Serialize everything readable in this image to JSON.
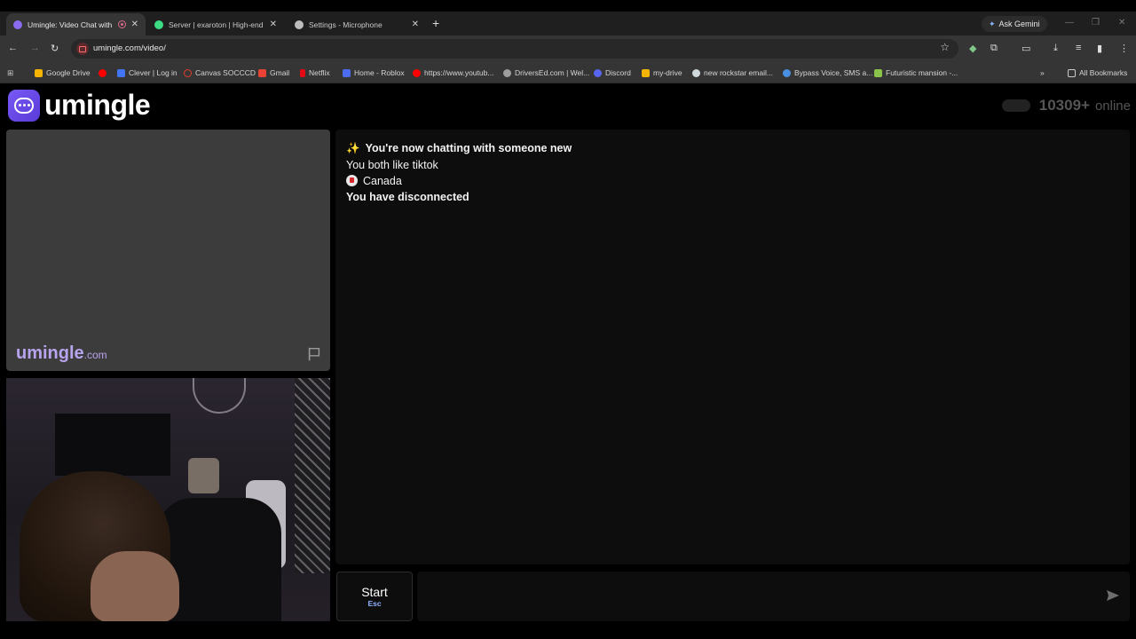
{
  "browser": {
    "tabs": [
      {
        "title": "Umingle: Video Chat with S",
        "active": true,
        "favicon_color": "#8b6cf0"
      },
      {
        "title": "Server | exaroton | High-end on",
        "active": false,
        "favicon_color": "#3ddc84"
      },
      {
        "title": "Settings - Microphone",
        "active": false,
        "favicon_color": "#bdbdbd"
      }
    ],
    "new_tab": "+",
    "ask_gemini": "Ask Gemini",
    "url": "umingle.com/video/",
    "bookmarks": [
      {
        "label": "Google Drive",
        "color": "#f4b400"
      },
      {
        "label": "",
        "color": "#ff0000"
      },
      {
        "label": "Clever | Log in",
        "color": "#4274f6"
      },
      {
        "label": "Canvas SOCCCD",
        "color": "#e13f2b"
      },
      {
        "label": "Gmail",
        "color": "#ea4335"
      },
      {
        "label": "Netflix",
        "color": "#e50914"
      },
      {
        "label": "Home - Roblox",
        "color": "#4b6cf0"
      },
      {
        "label": "https://www.youtub...",
        "color": "#ff0000"
      },
      {
        "label": "DriversEd.com | Wel...",
        "color": "#9e9e9e"
      },
      {
        "label": "Discord",
        "color": "#5865f2"
      },
      {
        "label": "my-drive",
        "color": "#f4b400"
      },
      {
        "label": "new rockstar email...",
        "color": "#cfd8dc"
      },
      {
        "label": "Bypass Voice, SMS a...",
        "color": "#4a90e2"
      },
      {
        "label": "Futuristic mansion -...",
        "color": "#8bc34a"
      }
    ],
    "overflow": "»",
    "all_bookmarks": "All Bookmarks"
  },
  "app": {
    "logo_text": "umingle",
    "online_count": "10309+",
    "online_label": "online",
    "watermark": "umingle",
    "watermark_suffix": ".com"
  },
  "chat": {
    "messages": [
      {
        "text": "You're now chatting with someone new",
        "bold": true,
        "icon": "sparkles-icon"
      },
      {
        "text": "You both like tiktok",
        "bold": false
      },
      {
        "text": "Canada",
        "bold": false,
        "icon": "canada-flag-icon"
      },
      {
        "text": "You have disconnected",
        "bold": true
      }
    ]
  },
  "controls": {
    "start_label": "Start",
    "start_key": "Esc",
    "input_value": "",
    "input_placeholder": ""
  }
}
